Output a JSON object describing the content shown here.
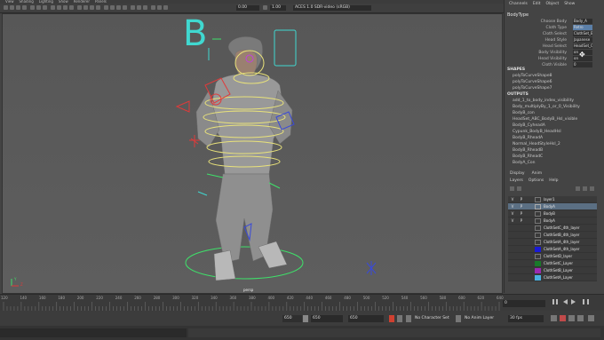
{
  "menu": [
    "View",
    "Shading",
    "Lighting",
    "Show",
    "Renderer",
    "Panels"
  ],
  "toolbar": {
    "field1": "0.00",
    "field2": "1.00",
    "colorspace": "ACES 1.0 SDR-video (sRGB)"
  },
  "viewport": {
    "camera": "persp",
    "axis_y": "Y",
    "axis_z": "Z",
    "big_letter": "B"
  },
  "channel_box": {
    "tabs": [
      "Channels",
      "Edit",
      "Object",
      "Show"
    ],
    "node": "BodyType",
    "attributes": [
      {
        "label": "Choose Body",
        "value": "Body_A"
      },
      {
        "label": "Cloth Type",
        "value": "Retro"
      },
      {
        "label": "Cloth Select",
        "value": "ClothSet_B"
      },
      {
        "label": "Head Style",
        "value": "Japanese"
      },
      {
        "label": "Head Select",
        "value": "HeadSet_C"
      },
      {
        "label": "Body Visibility",
        "value": "on"
      },
      {
        "label": "Head Visibility",
        "value": "on"
      },
      {
        "label": "Cloth Visible",
        "value": "0"
      }
    ],
    "shapes_header": "SHAPES",
    "shapes": [
      "polyToCurveShape8",
      "polyToCurveShape6",
      "polyToCurveShape7"
    ],
    "outputs_header": "OUTPUTS",
    "outputs": [
      "add_1_to_body_index_visibility",
      "Body_multiplyBy_1_or_0_Visibility",
      "BodyB_con",
      "HeadSet_ABC_BodyB_Hsl_visible",
      "BodyB_CyheadA",
      "Cypunk_BodyB_HeadHsl",
      "BodyB_RheadA",
      "Normal_HeadStyleHsl_2",
      "BodyB_RheadB",
      "BodyB_RheadC",
      "BodyA_Con"
    ]
  },
  "layer_editor": {
    "tabs": [
      "Display",
      "Anim"
    ],
    "menu": [
      "Layers",
      "Options",
      "Help"
    ],
    "layers": [
      {
        "v": "V",
        "p": "P",
        "name": "layer1",
        "color": "",
        "selected": false
      },
      {
        "v": "V",
        "p": "P",
        "name": "BodyA",
        "color": "",
        "selected": true
      },
      {
        "v": "V",
        "p": "P",
        "name": "BodyB",
        "color": "",
        "selected": false
      },
      {
        "v": "V",
        "p": "P",
        "name": "BodyA",
        "color": "",
        "selected": false
      },
      {
        "v": "",
        "p": "",
        "name": "ClothSetC_4th_layer",
        "color": "",
        "selected": false
      },
      {
        "v": "",
        "p": "",
        "name": "ClothSetB_4th_layer",
        "color": "",
        "selected": false
      },
      {
        "v": "",
        "p": "",
        "name": "ClothSetA_4th_layer",
        "color": "",
        "selected": false
      },
      {
        "v": "",
        "p": "",
        "name": "ClothSetA_4th_layer",
        "color": "#1a1ad6",
        "selected": false
      },
      {
        "v": "",
        "p": "",
        "name": "ClothSetD_layer",
        "color": "",
        "selected": false
      },
      {
        "v": "",
        "p": "",
        "name": "ClothSetC_Layer",
        "color": "#1a7a2a",
        "selected": false
      },
      {
        "v": "",
        "p": "",
        "name": "ClothSetB_Layer",
        "color": "#9a2ab0",
        "selected": false
      },
      {
        "v": "",
        "p": "",
        "name": "ClothSetA_Layer",
        "color": "#4ab0e0",
        "selected": false
      }
    ]
  },
  "timeline": {
    "ticks": [
      "120",
      "140",
      "160",
      "180",
      "200",
      "220",
      "240",
      "260",
      "280",
      "300",
      "320",
      "340",
      "360",
      "380",
      "400",
      "420",
      "440",
      "460",
      "480",
      "500",
      "520",
      "540",
      "560",
      "580",
      "600",
      "620",
      "640"
    ],
    "current_frame": "0"
  },
  "range": {
    "start_a": "650",
    "start_b": "650",
    "end_a": "650",
    "character_set": "No Character Set",
    "anim_layer": "No Anim Layer",
    "fps": "30 fps"
  },
  "colors": {
    "panel": "#444444",
    "viewport": "#5a5a5a",
    "selected_layer": "#5b6f83",
    "ctrl_green": "#3fe06a",
    "ctrl_red": "#e03a3a",
    "ctrl_yellow": "#e9e27a",
    "ctrl_cyan": "#40d8d0",
    "ctrl_blue": "#3a4ad8"
  }
}
